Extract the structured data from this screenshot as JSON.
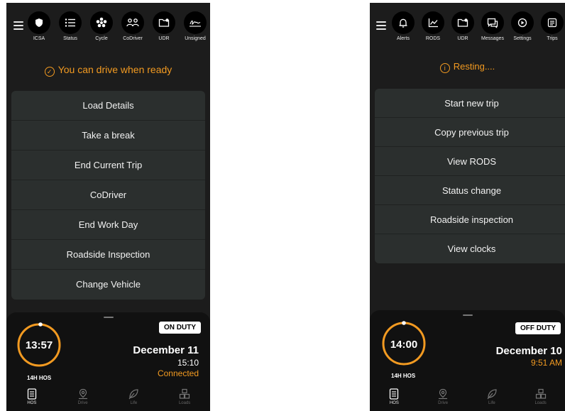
{
  "left": {
    "nav": [
      {
        "label": "ICSA",
        "icon": "shield-icon"
      },
      {
        "label": "Status",
        "icon": "list-icon"
      },
      {
        "label": "Cycle",
        "icon": "cycle-icon"
      },
      {
        "label": "CoDriver",
        "icon": "codriver-icon"
      },
      {
        "label": "UDR",
        "icon": "udr-icon"
      },
      {
        "label": "Unsigned",
        "icon": "unsigned-icon"
      }
    ],
    "status_text": "You can drive when ready",
    "menu": [
      "Load Details",
      "Take a break",
      "End Current Trip",
      "CoDriver",
      "End Work Day",
      "Roadside Inspection",
      "Change Vehicle"
    ],
    "clock_time": "13:57",
    "hos_label": "14H HOS",
    "duty_badge": "ON DUTY",
    "date": "December 11",
    "time": "15:10",
    "connection": "Connected",
    "bottom_nav": [
      {
        "label": "HOS"
      },
      {
        "label": "Drive"
      },
      {
        "label": "Life"
      },
      {
        "label": "Loads"
      }
    ]
  },
  "right": {
    "nav": [
      {
        "label": "Alerts",
        "icon": "bell-icon"
      },
      {
        "label": "RODS",
        "icon": "chart-icon"
      },
      {
        "label": "UDR",
        "icon": "udr-icon"
      },
      {
        "label": "Messages",
        "icon": "message-icon"
      },
      {
        "label": "Settings",
        "icon": "settings-icon"
      },
      {
        "label": "Trips",
        "icon": "trips-icon"
      }
    ],
    "status_text": "Resting....",
    "menu": [
      "Start new trip",
      "Copy previous trip",
      "View RODS",
      "Status change",
      "Roadside inspection",
      "View clocks"
    ],
    "clock_time": "14:00",
    "hos_label": "14H HOS",
    "duty_badge": "OFF DUTY",
    "date": "December 10",
    "time": "9:51 AM",
    "bottom_nav": [
      {
        "label": "HOS"
      },
      {
        "label": "Drive"
      },
      {
        "label": "Life"
      },
      {
        "label": "Loads"
      }
    ]
  },
  "colors": {
    "accent": "#f29a21",
    "panel": "#1c1c1c",
    "menu_bg": "#2b2f2e"
  }
}
